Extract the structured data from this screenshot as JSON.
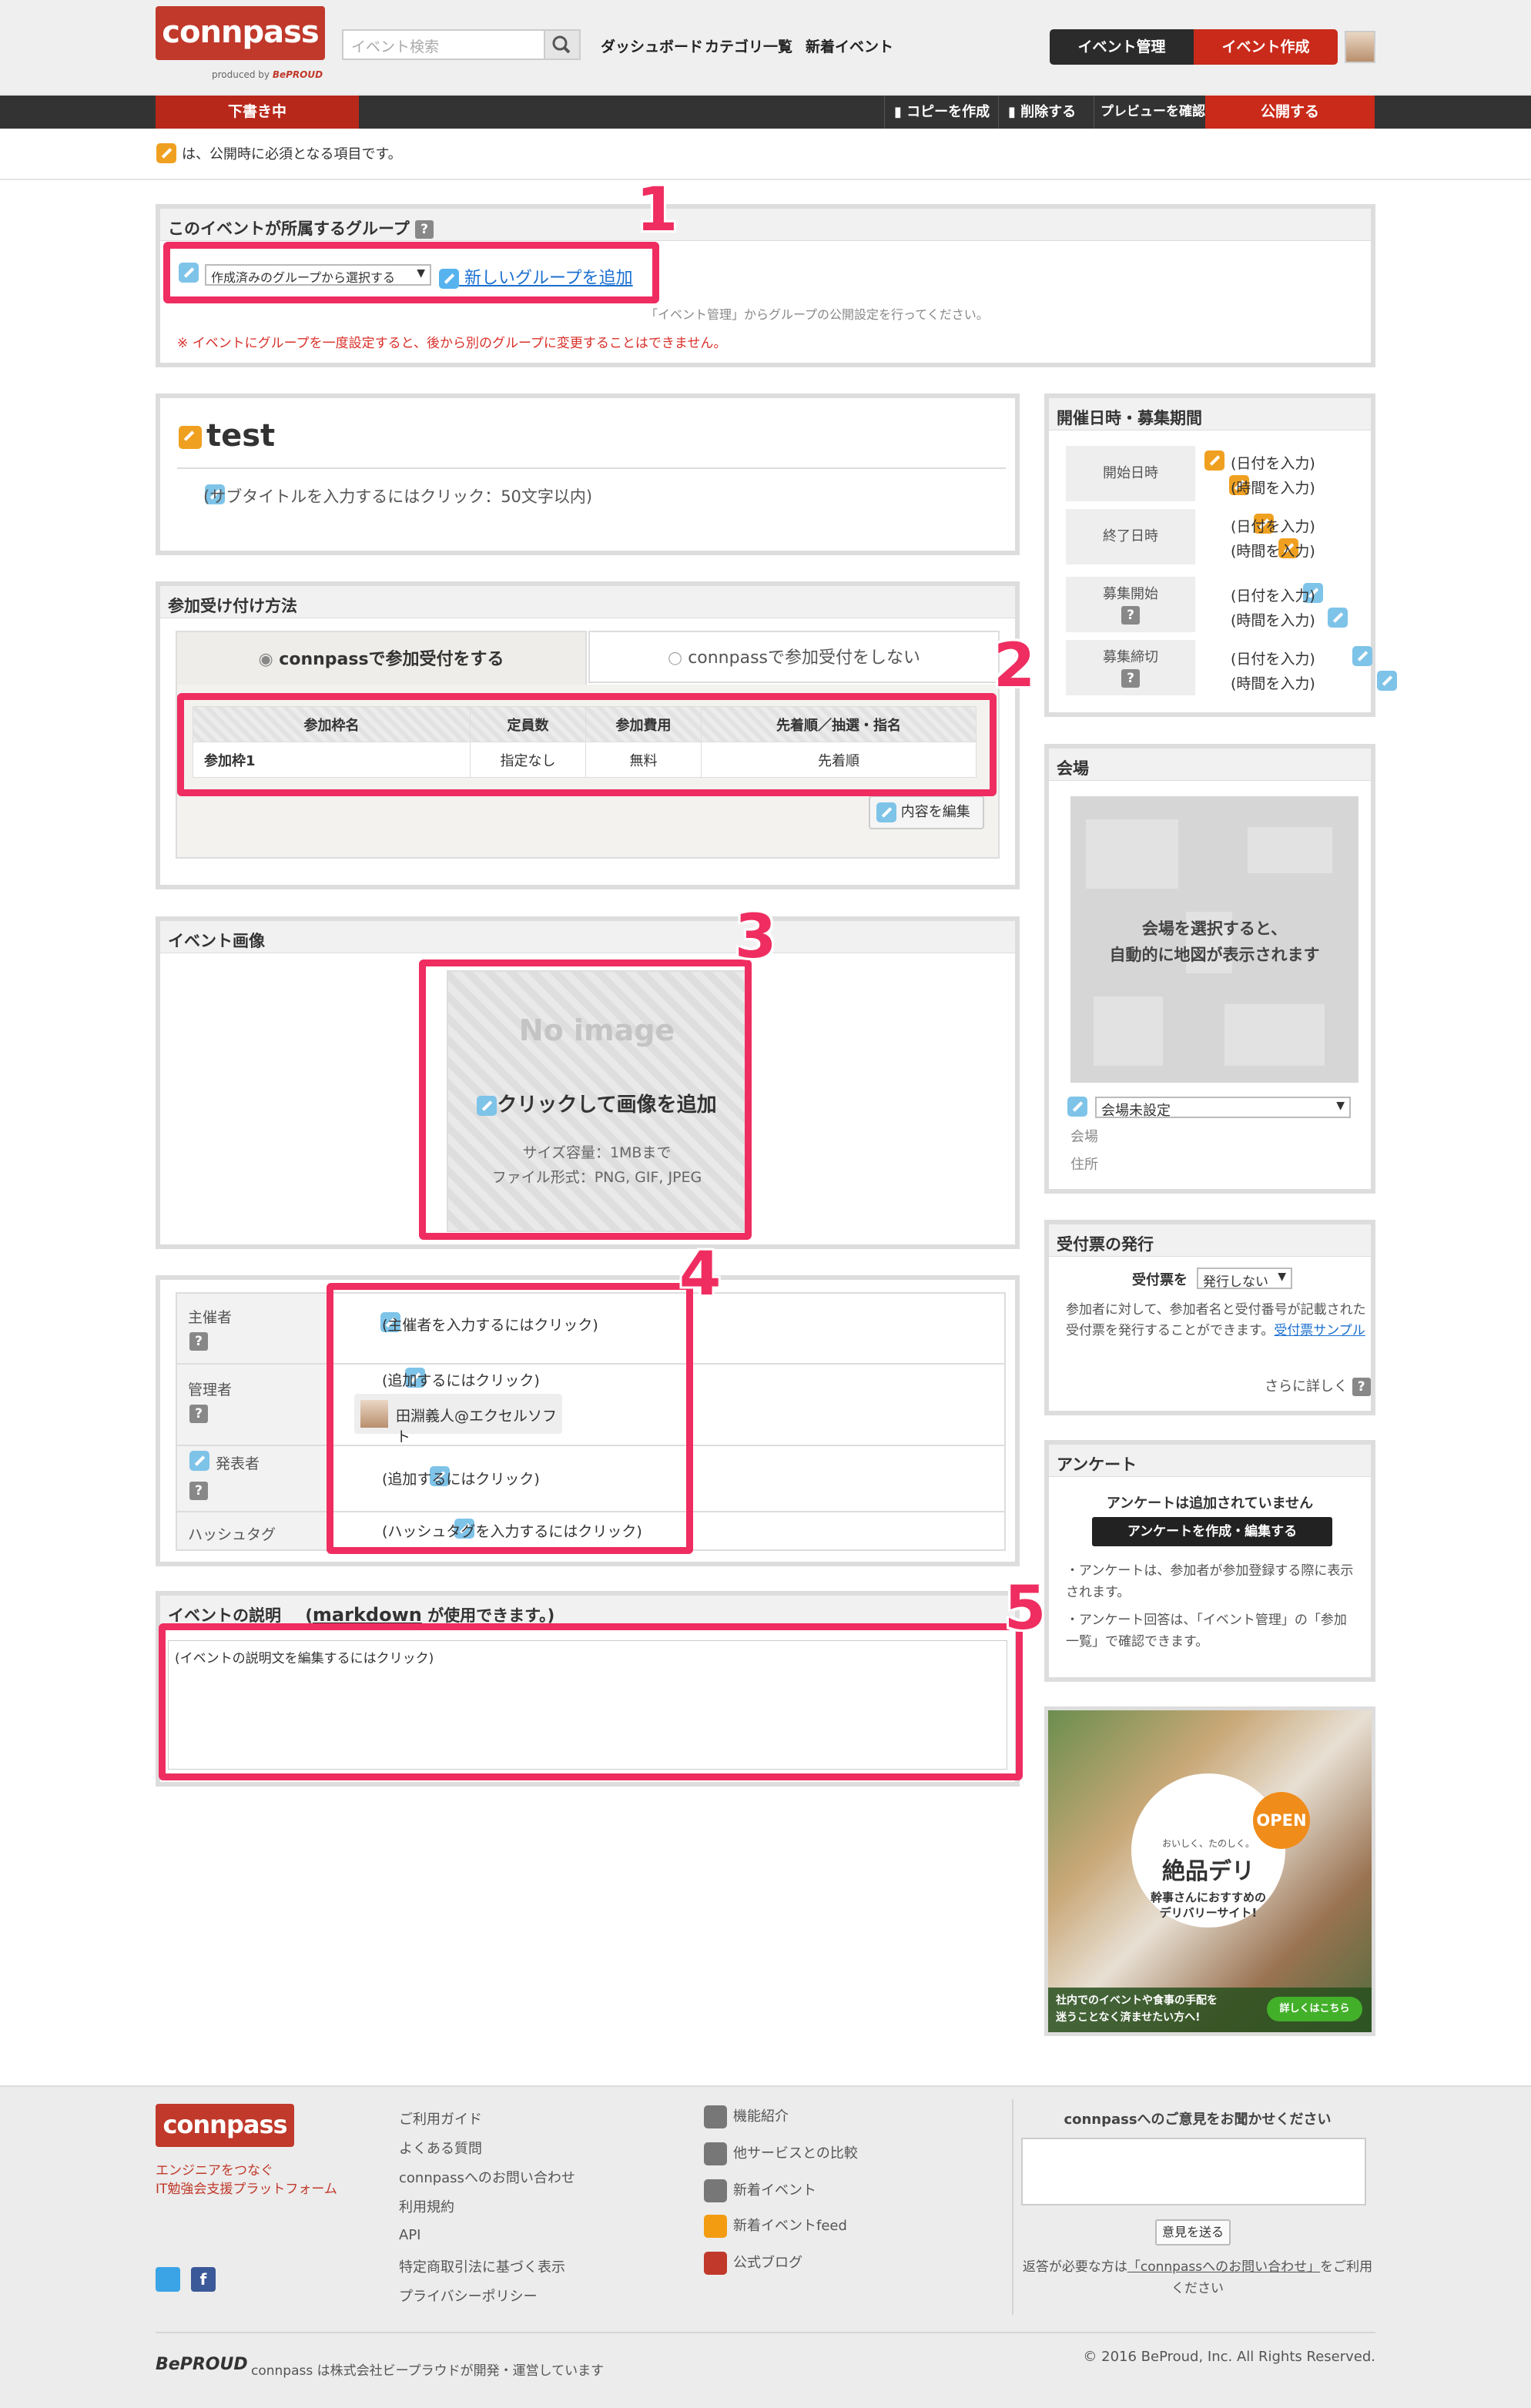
{
  "header": {
    "logo_text": "connpass",
    "produced_by": "produced by",
    "brand_mark": "BePROUD",
    "search_placeholder": "イベント検索",
    "nav": [
      "ダッシュボード",
      "カテゴリ一覧",
      "新着イベント"
    ],
    "manage_label": "イベント管理",
    "create_label": "イベント作成"
  },
  "toolbar": {
    "status": "下書き中",
    "copy": "コピーを作成",
    "delete": "削除する",
    "preview": "プレビューを確認",
    "publish": "公開する"
  },
  "notice_text": "は、公開時に必須となる項目です。",
  "group_panel": {
    "title": "このイベントが所属するグループ",
    "select_value": "作成済みのグループから選択する",
    "add_link": "新しいグループを追加",
    "note1": "「イベント管理」からグループの公開設定を行ってください。",
    "note2": "※ イベントにグループを一度設定すると、後から別のグループに変更することはできません。"
  },
  "title_panel": {
    "title": "test",
    "subtitle_placeholder": "(サブタイトルを入力するにはクリック：50文字以内)"
  },
  "reception": {
    "title": "参加受け付け方法",
    "tab_on": "connpassで参加受付をする",
    "tab_off": "connpassで参加受付をしない",
    "headers": [
      "参加枠名",
      "定員数",
      "参加費用",
      "先着順／抽選・指名"
    ],
    "rows": [
      [
        "参加枠1",
        "指定なし",
        "無料",
        "先着順"
      ]
    ],
    "edit_label": "内容を編集"
  },
  "image_panel": {
    "title": "イベント画像",
    "no_image": "No image",
    "add_label": "クリックして画像を追加",
    "size_limit": "サイズ容量：1MBまで",
    "formats": "ファイル形式：PNG, GIF, JPEG"
  },
  "people": {
    "organizer_label": "主催者",
    "organizer_placeholder": "(主催者を入力するにはクリック)",
    "admin_label": "管理者",
    "admin_placeholder": "(追加するにはクリック)",
    "admin_user": "田淵義人@エクセルソフト",
    "speaker_label": "発表者",
    "speaker_placeholder": "(追加するにはクリック)",
    "hashtag_label": "ハッシュタグ",
    "hashtag_placeholder": "(ハッシュタグを入力するにはクリック)"
  },
  "description": {
    "title_prefix": "イベントの説明",
    "markdown": "markdown",
    "title_suffix": "が使用できます。)",
    "open_paren": "(",
    "placeholder": "(イベントの説明文を編集するにはクリック)"
  },
  "annotations": [
    "1",
    "2",
    "3",
    "4",
    "5"
  ],
  "schedule": {
    "title": "開催日時・募集期間",
    "start_label": "開始日時",
    "end_label": "終了日時",
    "open_label": "募集開始",
    "close_label": "募集締切",
    "date_placeholder": "(日付を入力)",
    "time_placeholder": "(時間を入力)"
  },
  "venue": {
    "title": "会場",
    "map_text_1": "会場を選択すると、",
    "map_text_2": "自動的に地図が表示されます",
    "select_value": "会場未設定",
    "venue_label": "会場",
    "address_label": "住所"
  },
  "ticket": {
    "title": "受付票の発行",
    "label": "受付票を",
    "select_value": "発行しない",
    "desc": "参加者に対して、参加者名と受付番号が記載された受付票を発行することができます。",
    "sample_link": "受付票サンプル",
    "more": "さらに詳しく"
  },
  "survey": {
    "title": "アンケート",
    "status": "アンケートは追加されていません",
    "button": "アンケートを作成・編集する",
    "note1": "アンケートは、参加者が参加登録する際に表示されます。",
    "note2": "アンケート回答は、「イベント管理」の「参加一覧」で確認できます。"
  },
  "ad": {
    "open_badge": "OPEN",
    "tagline": "おいしく、たのしく。",
    "brand": "絶品デリ",
    "sub1": "幹事さんにおすすめの",
    "sub2": "デリバリーサイト!",
    "bottom1": "社内でのイベントや食事の手配を",
    "bottom2": "迷うことなく済ませたい方へ!",
    "details": "詳しくはこちら"
  },
  "footer": {
    "tagline1": "エンジニアをつなぐ",
    "tagline2": "IT勉強会支援プラットフォーム",
    "col1": [
      "ご利用ガイド",
      "よくある質問",
      "connpassへのお問い合わせ",
      "利用規約",
      "API",
      "特定商取引法に基づく表示",
      "プライバシーポリシー"
    ],
    "col2": [
      "機能紹介",
      "他サービスとの比較",
      "新着イベント",
      "新着イベントfeed",
      "公式ブログ"
    ],
    "feedback_title": "connpassへのご意見をお聞かせください",
    "send": "意見を送る",
    "reply_note_1": "返答が必要な方は",
    "reply_link": "「connpassへのお問い合わせ」",
    "reply_note_2": "をご利用ください",
    "copyright": "© 2016 BeProud, Inc. All Rights Reserved.",
    "operated": "connpass は株式会社ビープラウドが開発・運営しています"
  }
}
